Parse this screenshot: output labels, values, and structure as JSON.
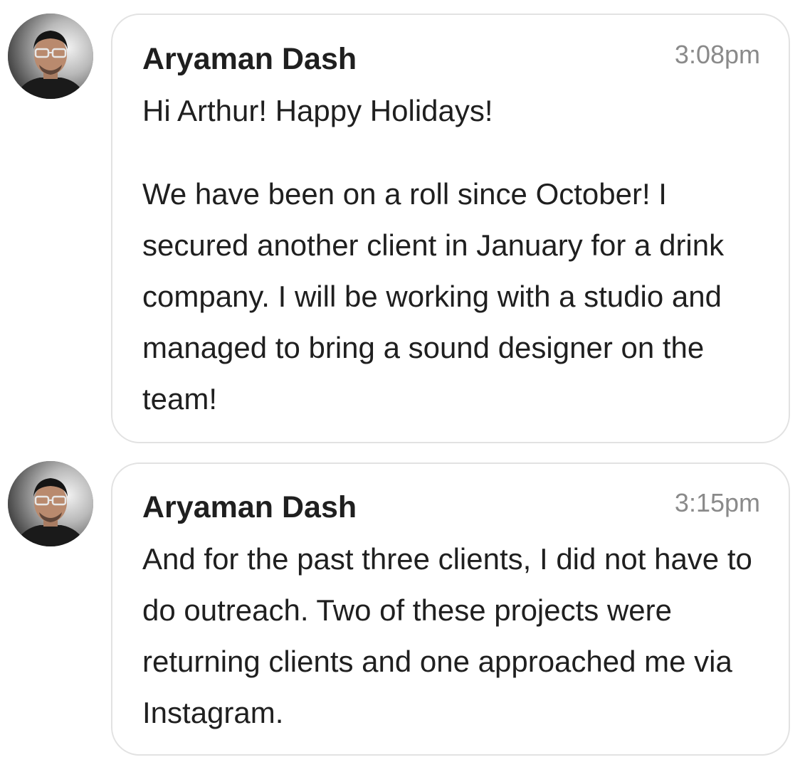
{
  "messages": [
    {
      "sender": "Aryaman Dash",
      "time": "3:08pm",
      "avatar_icon": "user-avatar-photo",
      "paragraphs": [
        "Hi Arthur! Happy Holidays!",
        "We have been on a roll since October! I secured another client in January for a drink company. I will be working with a studio and managed to bring a sound designer on the team!"
      ]
    },
    {
      "sender": "Aryaman Dash",
      "time": "3:15pm",
      "avatar_icon": "user-avatar-photo",
      "paragraphs": [
        "And for the past three clients, I did not have to do outreach. Two of these projects were returning clients and one approached me via Instagram."
      ]
    }
  ],
  "colors": {
    "bubble_border": "#e2e2e2",
    "text": "#1f1f1f",
    "timestamp": "#8a8a8a",
    "background": "#ffffff"
  }
}
